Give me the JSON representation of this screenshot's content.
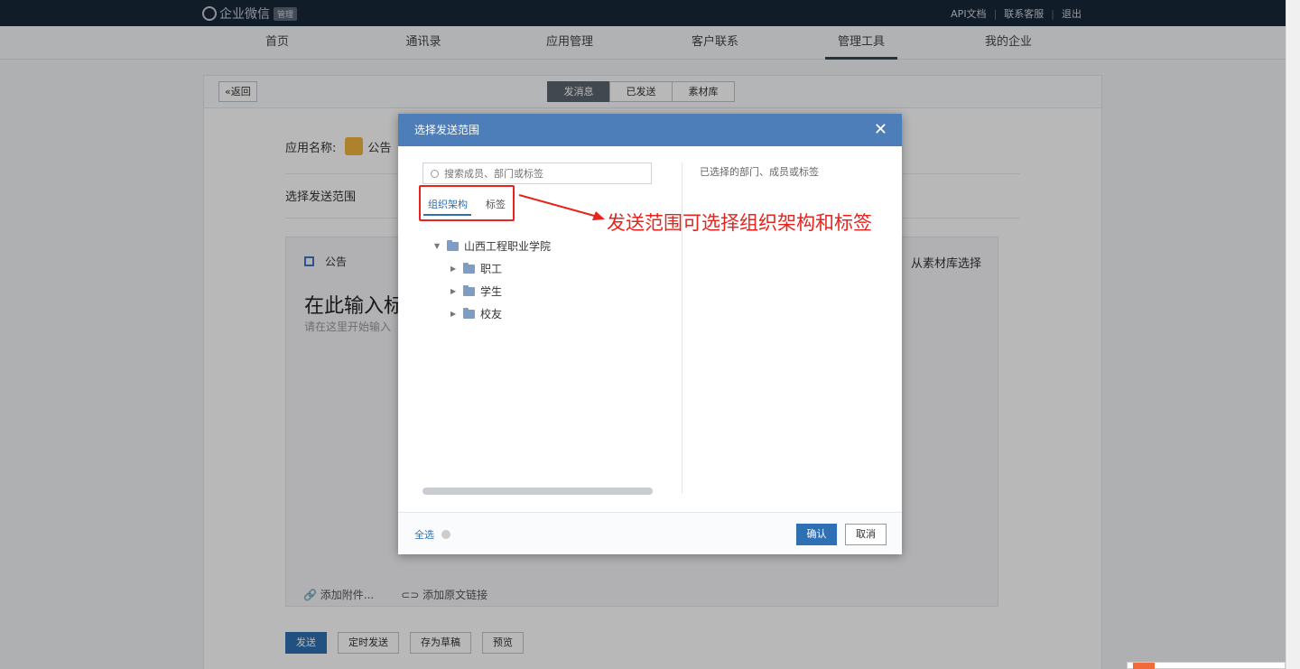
{
  "header": {
    "logo_text": "企业微信",
    "logo_badge": "管理",
    "links": [
      "API文档",
      "联系客服",
      "退出"
    ]
  },
  "nav": {
    "items": [
      "首页",
      "通讯录",
      "应用管理",
      "客户联系",
      "管理工具",
      "我的企业"
    ],
    "active": "管理工具"
  },
  "page": {
    "back_label": "«返回",
    "seg_tabs": [
      "发消息",
      "已发送",
      "素材库"
    ],
    "app_name_label": "应用名称:",
    "app_name_value": "公告",
    "scope_label": "选择发送范围",
    "editor_tab": "公告",
    "from_library": "从素材库选择",
    "title_placeholder": "在此输入标",
    "body_placeholder": "请在这里开始输入",
    "attach_file": "添加附件...",
    "attach_link": "添加原文链接",
    "buttons": [
      "发送",
      "定时发送",
      "存为草稿",
      "预览"
    ]
  },
  "dialog": {
    "title": "选择发送范围",
    "close_glyph": "✕",
    "search_placeholder": "搜索成员、部门或标签",
    "tabs": [
      "组织架构",
      "标签"
    ],
    "tree_root": "山西工程职业学院",
    "tree_children": [
      "职工",
      "学生",
      "校友"
    ],
    "selected_label": "已选择的部门、成员或标签",
    "select_all": "全选",
    "ok": "确认",
    "cancel": "取消"
  },
  "annotation": {
    "text": "发送范围可选择组织架构和标签",
    "color": "#e8231d"
  }
}
